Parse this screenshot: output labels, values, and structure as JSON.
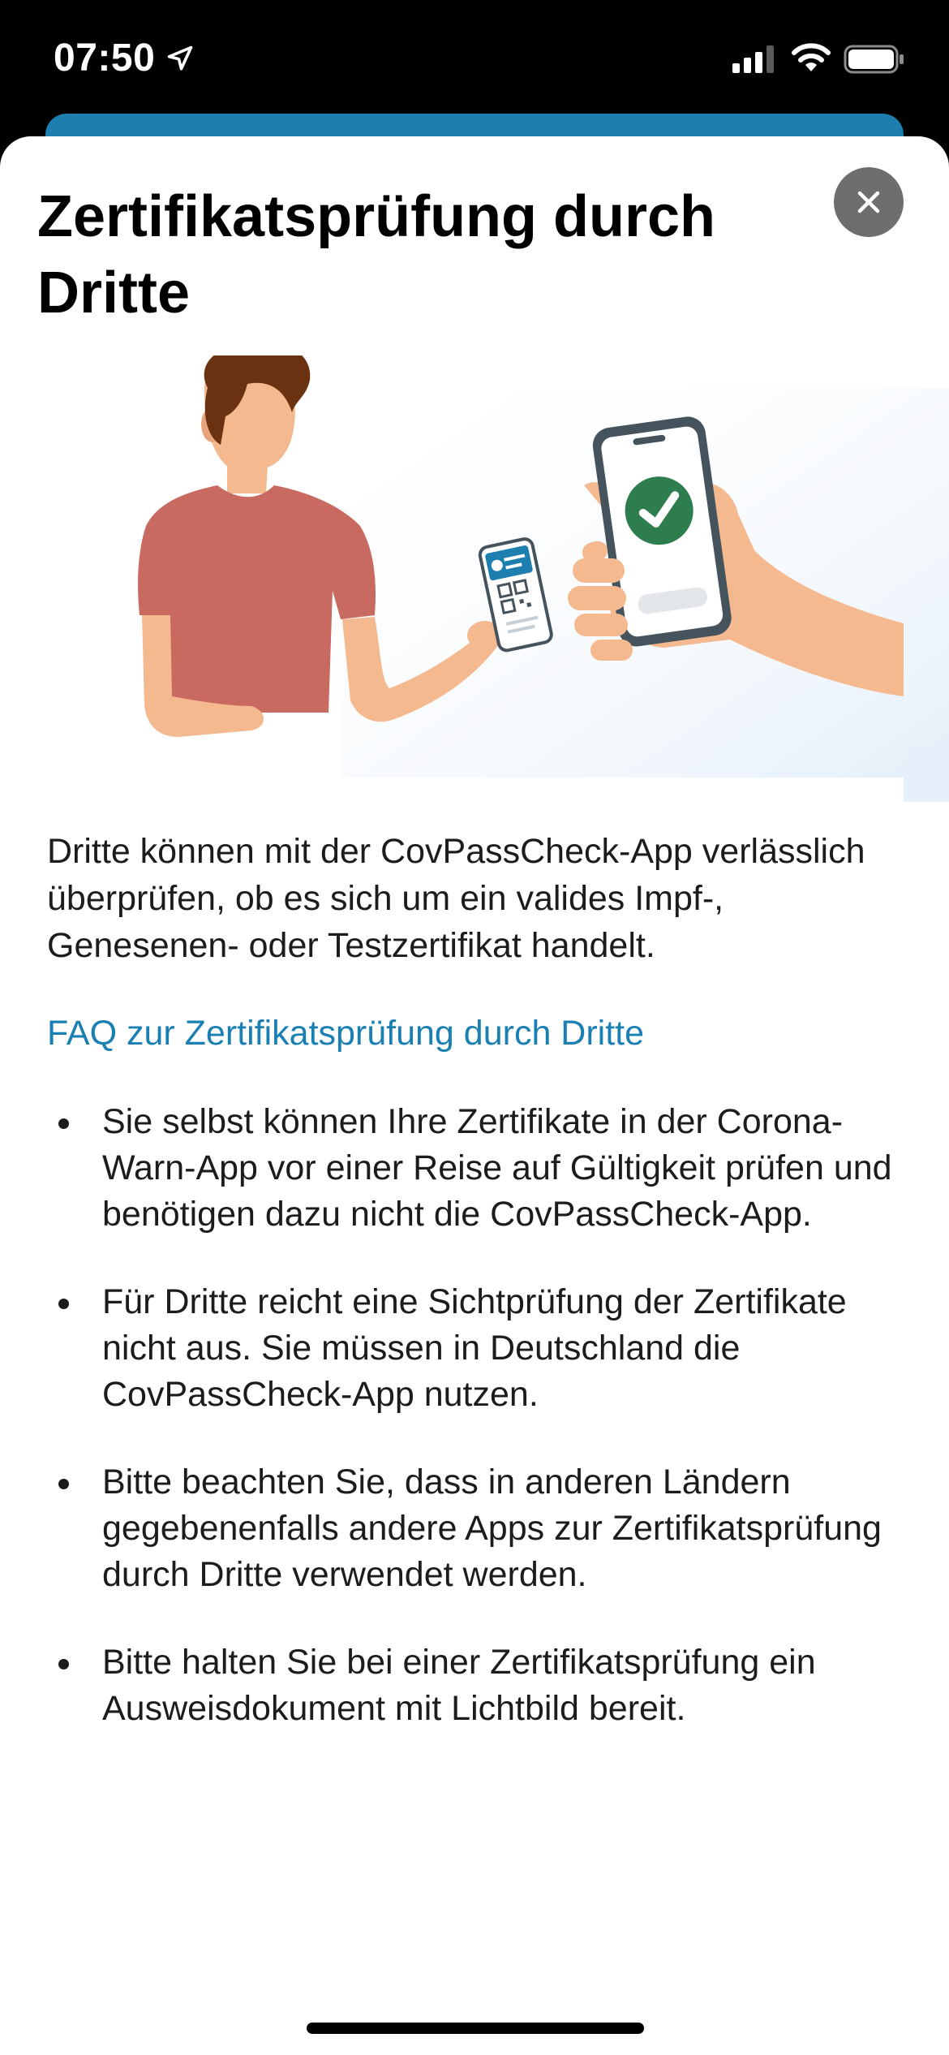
{
  "status_bar": {
    "time": "07:50"
  },
  "sheet": {
    "title": "Zertifikatsprüfung durch Dritte",
    "close_icon": "close-icon",
    "intro": "Dritte können mit der CovPassCheck-App verlässlich überprüfen, ob es sich um ein valides Impf-, Genesenen- oder Testzertifikat handelt.",
    "faq_link": "FAQ zur Zertifikatsprüfung durch Dritte",
    "bullets": [
      "Sie selbst können Ihre Zertifikate in der Corona-Warn-App vor einer Reise auf Gültigkeit prüfen und benötigen dazu nicht die CovPassCheck-App.",
      "Für Dritte reicht eine Sichtprüfung der Zertifikate nicht aus. Sie müssen in Deutschland die CovPassCheck-App nutzen.",
      "Bitte beachten Sie, dass in anderen Ländern gegebenenfalls andere Apps zur Zertifikatsprüfung durch Dritte verwendet werden.",
      "Bitte halten Sie bei einer Zertifikatsprüfung ein Ausweisdokument mit Lichtbild bereit."
    ]
  },
  "colors": {
    "accent": "#1a7fb2",
    "check_green": "#2e7d4f",
    "shirt": "#c96a60",
    "skin": "#f5b990",
    "hair": "#6b3212"
  }
}
